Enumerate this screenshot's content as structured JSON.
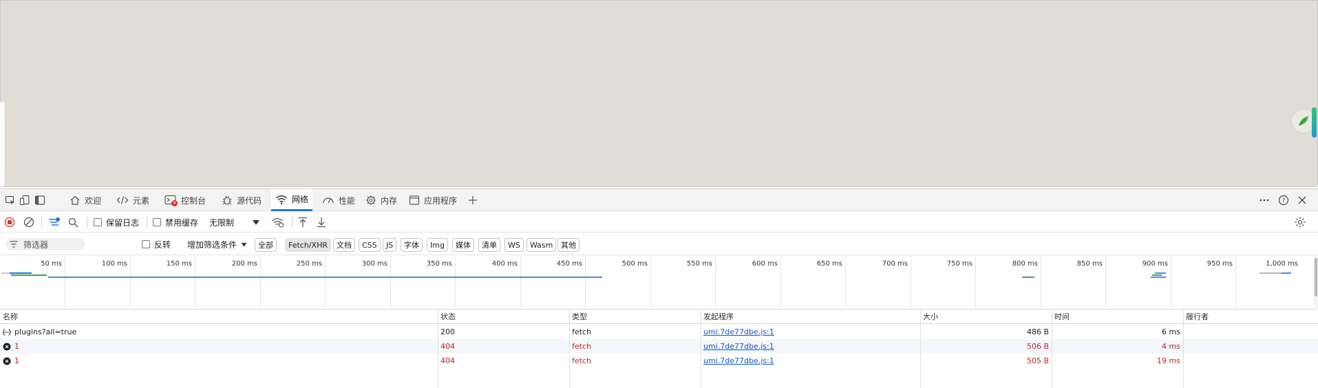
{
  "tabs": [
    {
      "label": "欢迎",
      "icon": "home-icon"
    },
    {
      "label": "元素",
      "icon": "code-icon"
    },
    {
      "label": "控制台",
      "icon": "console-icon"
    },
    {
      "label": "源代码",
      "icon": "bug-icon"
    },
    {
      "label": "网络",
      "icon": "wifi-icon",
      "active": true
    },
    {
      "label": "性能",
      "icon": "gauge-icon"
    },
    {
      "label": "内存",
      "icon": "memory-icon"
    },
    {
      "label": "应用程序",
      "icon": "app-icon"
    }
  ],
  "toolbar": {
    "preserve_log": "保留日志",
    "disable_cache": "禁用缓存",
    "throttling": "无限制"
  },
  "filter": {
    "placeholder": "筛选器",
    "invert": "反转",
    "more_filters": "增加筛选条件",
    "chips": [
      "全部",
      "Fetch/XHR",
      "文档",
      "CSS",
      "JS",
      "字体",
      "Img",
      "媒体",
      "清单",
      "WS",
      "Wasm",
      "其他"
    ],
    "active_chip": "Fetch/XHR"
  },
  "timeline": {
    "ticks": [
      "50 ms",
      "100 ms",
      "150 ms",
      "200 ms",
      "250 ms",
      "300 ms",
      "350 ms",
      "400 ms",
      "450 ms",
      "500 ms",
      "550 ms",
      "600 ms",
      "650 ms",
      "700 ms",
      "750 ms",
      "800 ms",
      "850 ms",
      "900 ms",
      "950 ms",
      "1,000 ms"
    ]
  },
  "table": {
    "headers": [
      "名称",
      "状态",
      "类型",
      "发起程序",
      "大小",
      "时间",
      "履行者"
    ],
    "rows": [
      {
        "name": "plugins?all=true",
        "status": "200",
        "type": "fetch",
        "initiator": "umi.7de77dbe.js:1",
        "size": "486 B",
        "time": "6 ms",
        "fulfilled": "",
        "error": false
      },
      {
        "name": "1",
        "status": "404",
        "type": "fetch",
        "initiator": "umi.7de77dbe.js:1",
        "size": "506 B",
        "time": "4 ms",
        "fulfilled": "",
        "error": true
      },
      {
        "name": "1",
        "status": "404",
        "type": "fetch",
        "initiator": "umi.7de77dbe.js:1",
        "size": "505 B",
        "time": "19 ms",
        "fulfilled": "",
        "error": true
      }
    ]
  },
  "colors": {
    "accent": "#1a73e8",
    "error": "#c5221f",
    "record": "#d93025"
  }
}
